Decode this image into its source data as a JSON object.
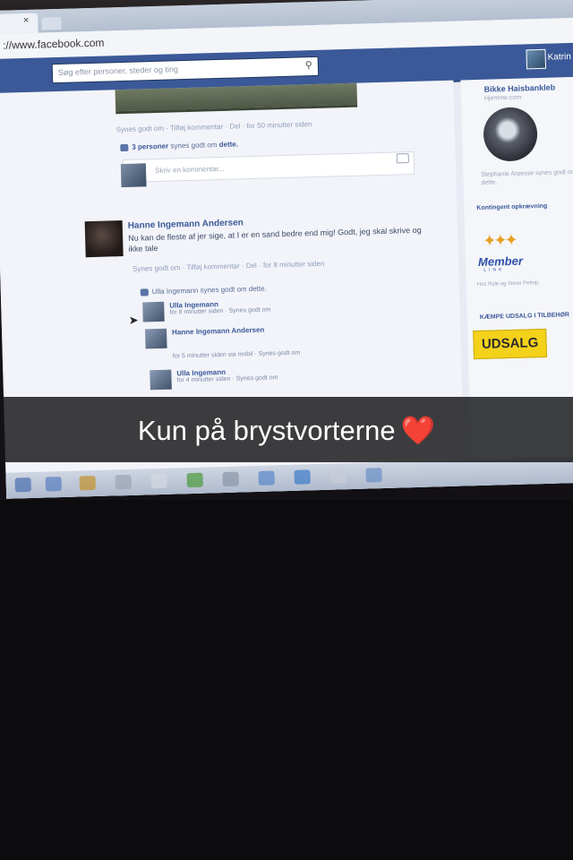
{
  "browser": {
    "url": "://www.facebook.com",
    "tab_close": "×"
  },
  "facebook": {
    "search_placeholder": "Søg efter personer, steder og ting",
    "user_name": "Katrin",
    "feed": {
      "meta_line_1": "Synes godt om · Tilføj kommentar · Del · for 50 minutter siden",
      "likes_prefix": "3 personer",
      "likes_suffix": "synes godt om",
      "likes_target": "dette.",
      "comment_placeholder": "Skriv en kommentar...",
      "post_author": "Hanne Ingemann Andersen",
      "post_text": "Nu kan de fleste af jer sige, at I er en sand bedre end mig! Godt, jeg skal skrive og ikke tale",
      "post_meta": "Synes godt om · Tilføj kommentar · Del · for 8 minutter siden",
      "replies_like": "Ulla Ingemann synes godt om dette.",
      "replies": [
        {
          "author": "Ulla Ingemann",
          "text": "for 8 minutter siden · Synes godt om"
        },
        {
          "author": "Hanne Ingemann Andersen",
          "text": "for 5 minutter siden via mobil · Synes godt om"
        },
        {
          "author": "Ulla Ingemann",
          "text": "for 4 minutter siden · Synes godt om"
        }
      ]
    },
    "sidebar": {
      "profile_name": "Bikke Haisbankleb",
      "profile_sub": "Hjemme.com",
      "caption": "Stephanie Arpesse synes godt om dette.",
      "section_1": "Kontingent opkrævning",
      "member_word": "Member",
      "member_sub": "LINK",
      "member_caption": "Hos Ryle og Steve Pettrip",
      "section_2": "KÆMPE UDSALG I TILBEHØR",
      "udsalg": "UDSALG"
    }
  },
  "caption": {
    "text": "Kun på brystvorterne",
    "emoji": "❤️"
  }
}
